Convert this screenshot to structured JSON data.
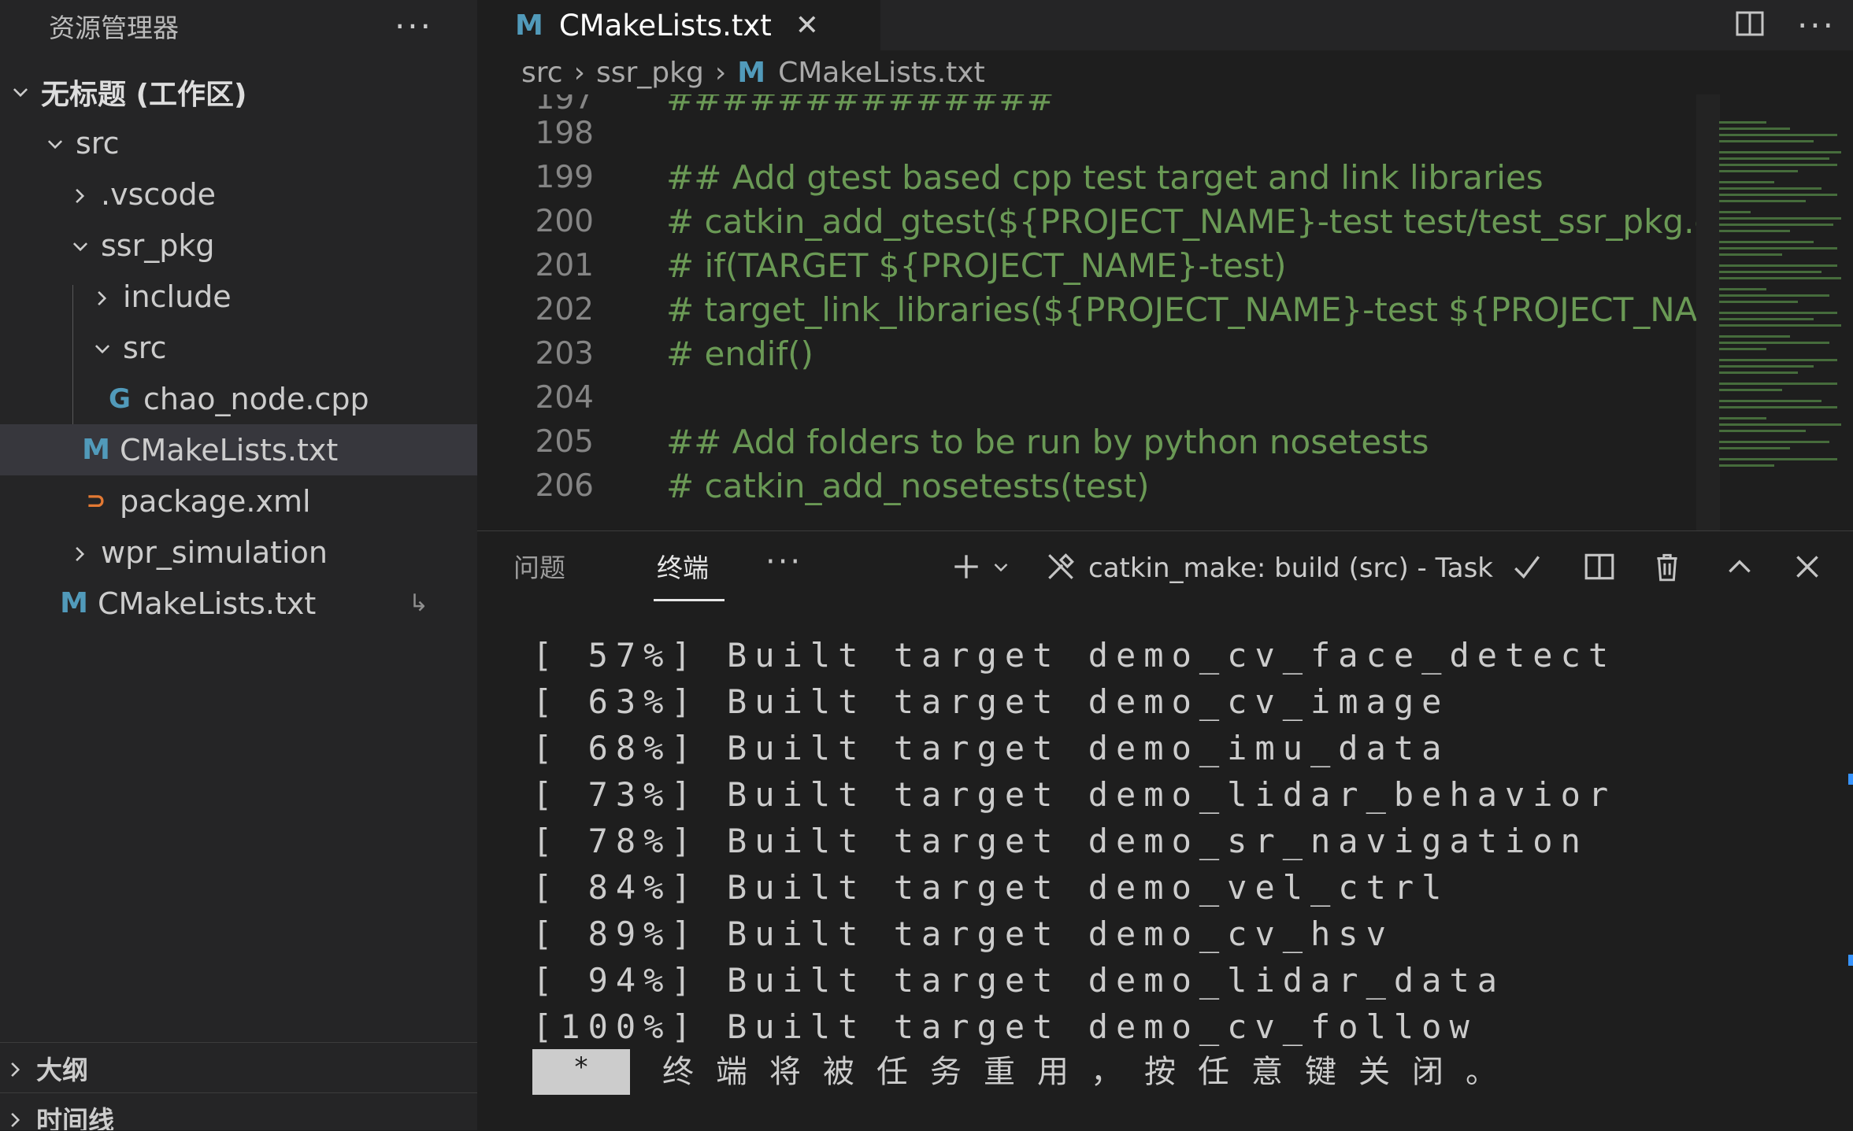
{
  "sidebar": {
    "title": "资源管理器",
    "more": "···",
    "tree": [
      {
        "label": "无标题 (工作区)",
        "badge": ""
      },
      {
        "label": "src",
        "badge": ""
      },
      {
        "label": ".vscode",
        "badge": ""
      },
      {
        "label": "ssr_pkg",
        "badge": ""
      },
      {
        "label": "include",
        "badge": ""
      },
      {
        "label": "src",
        "badge": ""
      },
      {
        "label": "chao_node.cpp",
        "badge": ""
      },
      {
        "label": "CMakeLists.txt",
        "badge": ""
      },
      {
        "label": "package.xml",
        "badge": ""
      },
      {
        "label": "wpr_simulation",
        "badge": ""
      },
      {
        "label": "CMakeLists.txt",
        "badge": "↳"
      }
    ],
    "sections": [
      {
        "label": "大纲"
      },
      {
        "label": "时间线"
      }
    ]
  },
  "editor": {
    "tab": {
      "label": "CMakeLists.txt",
      "close": "✕"
    },
    "more": "···",
    "breadcrumb": [
      "src",
      "ssr_pkg",
      "CMakeLists.txt"
    ],
    "lines": [
      {
        "num": "197",
        "text": "##############"
      },
      {
        "num": "198",
        "text": ""
      },
      {
        "num": "199",
        "text": "## Add gtest based cpp test target and link libraries"
      },
      {
        "num": "200",
        "text": "# catkin_add_gtest(${PROJECT_NAME}-test test/test_ssr_pkg.cpp)"
      },
      {
        "num": "201",
        "text": "# if(TARGET ${PROJECT_NAME}-test)"
      },
      {
        "num": "202",
        "text": "#   target_link_libraries(${PROJECT_NAME}-test ${PROJECT_NAME})"
      },
      {
        "num": "203",
        "text": "# endif()"
      },
      {
        "num": "204",
        "text": ""
      },
      {
        "num": "205",
        "text": "## Add folders to be run by python nosetests"
      },
      {
        "num": "206",
        "text": "# catkin_add_nosetests(test)"
      }
    ]
  },
  "panel": {
    "tabs": [
      "问题",
      "终端"
    ],
    "more": "···",
    "task": "catkin_make: build (src) - Task",
    "terminal_lines": [
      "[ 57%] Built target demo_cv_face_detect",
      "[ 63%] Built target demo_cv_image",
      "[ 68%] Built target demo_imu_data",
      "[ 73%] Built target demo_lidar_behavior",
      "[ 78%] Built target demo_sr_navigation",
      "[ 84%] Built target demo_vel_ctrl",
      "[ 89%] Built target demo_cv_hsv",
      "[ 94%] Built target demo_lidar_data",
      "[100%] Built target demo_cv_follow"
    ],
    "cursor": "*",
    "reuse_message": "终端将被任务重用，按任意键关闭。"
  },
  "colors": {
    "sidebar_bg": "#252526",
    "editor_bg": "#1e1e1e",
    "comment": "#6a9955",
    "cmake_icon": "#519aba",
    "xml_icon": "#e37933"
  }
}
